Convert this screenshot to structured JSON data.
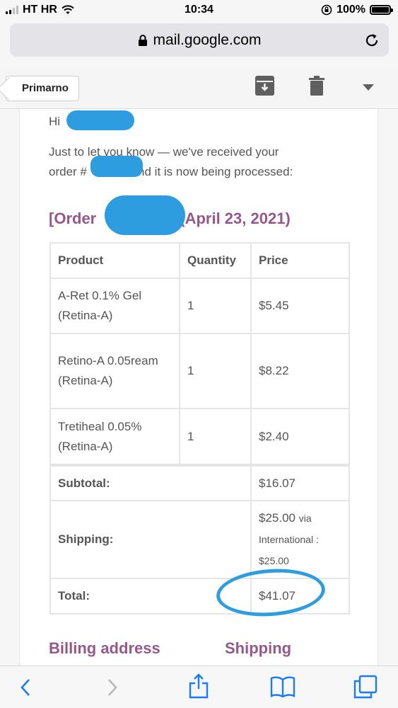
{
  "status_bar": {
    "carrier": "HT HR",
    "time": "10:34",
    "battery": "100%"
  },
  "browser": {
    "url": "mail.google.com"
  },
  "gmail_toolbar": {
    "back_label": "Primarno"
  },
  "email": {
    "greeting": "Hi",
    "intro_line1": "Just to let you know — we've received your",
    "intro_line2_prefix": "order #",
    "intro_line2_suffix": " and it is now being processed:",
    "order_heading_prefix": "[Order",
    "order_heading_suffix": "(April 23, 2021)",
    "table": {
      "headers": [
        "Product",
        "Quantity",
        "Price"
      ],
      "rows": [
        {
          "product": "A-Ret 0.1% Gel (Retina-A)",
          "quantity": "1",
          "price": "$5.45"
        },
        {
          "product": "Retino-A 0.05ream (Retina-A)",
          "quantity": "1",
          "price": "$8.22"
        },
        {
          "product": "Tretiheal 0.05% (Retina-A)",
          "quantity": "1",
          "price": "$2.40"
        }
      ],
      "subtotal_label": "Subtotal:",
      "subtotal_value": "$16.07",
      "shipping_label": "Shipping:",
      "shipping_value": "$25.00",
      "shipping_via": "via",
      "shipping_method": "International :",
      "shipping_method_price": "$25.00",
      "total_label": "Total:",
      "total_value": "$41.07"
    },
    "billing_heading": "Billing address",
    "shipping_heading": "Shipping"
  },
  "colors": {
    "accent": "#96588a",
    "scribble": "#2e9de0",
    "ios_blue": "#1a7cf5"
  },
  "icons": {
    "toolbar": [
      "archive-icon",
      "trash-icon",
      "more-dropdown-icon"
    ],
    "bottom": [
      "back-icon",
      "forward-icon",
      "share-icon",
      "bookmarks-icon",
      "tabs-icon"
    ]
  }
}
